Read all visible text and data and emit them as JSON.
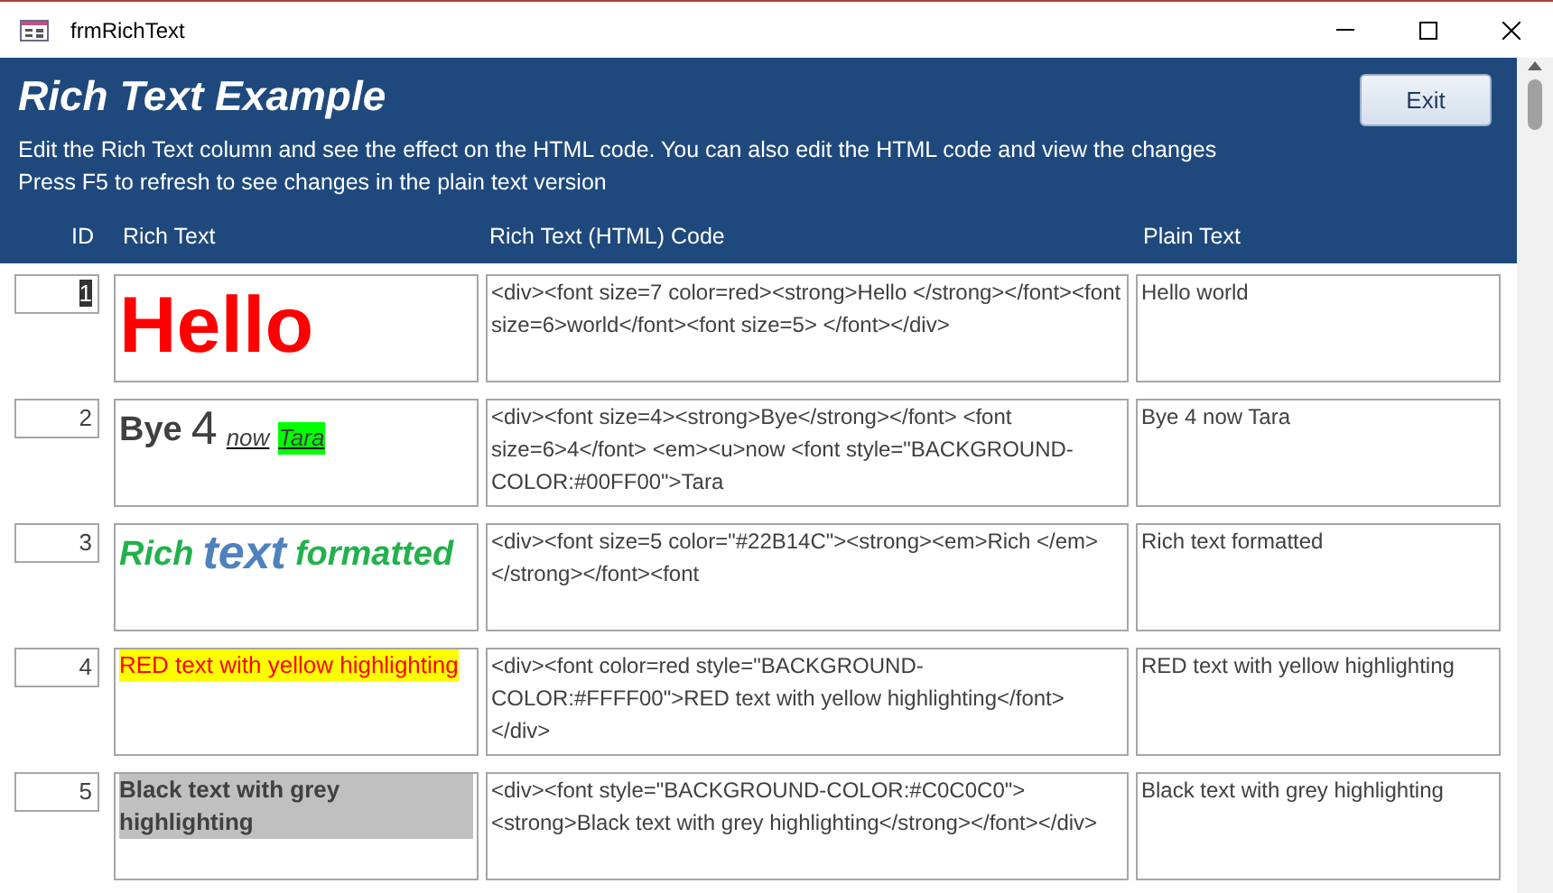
{
  "window": {
    "title": "frmRichText"
  },
  "header": {
    "title": "Rich Text Example",
    "exit_button": "Exit",
    "instructions": [
      "Edit the Rich Text column and see the effect on the HTML code. You can also edit the HTML code and view the changes",
      "Press F5 to refresh to see changes in the plain text version"
    ]
  },
  "table": {
    "columns": [
      "ID",
      "Rich Text",
      "Rich Text (HTML) Code",
      "Plain Text"
    ],
    "rows": [
      {
        "id": "1",
        "selected": true,
        "rich_text": [
          {
            "text": "Hello",
            "kind": "huge",
            "color": "#ff0000",
            "bold": true,
            "italic": false,
            "underline": false
          }
        ],
        "html_code": "<div><font size=7 color=red><strong>Hello </strong></font><font size=6>world</font><font size=5> </font></div>",
        "plain_text": "Hello world"
      },
      {
        "id": "2",
        "selected": false,
        "rich_text": [
          {
            "text": "Bye",
            "kind": "medium",
            "bold": true,
            "italic": false,
            "underline": false
          },
          {
            "text": "4",
            "kind": "large",
            "bold": false,
            "italic": false,
            "underline": false
          },
          {
            "text": "now",
            "kind": "normal",
            "bold": false,
            "italic": true,
            "underline": true
          },
          {
            "text": "Tara",
            "kind": "normal",
            "bold": false,
            "italic": true,
            "underline": true,
            "highlight": {
              "color": "#00ff00"
            }
          }
        ],
        "html_code": "<div><font size=4><strong>Bye</strong></font> <font size=6>4</font> <em><u>now <font style=\"BACKGROUND-COLOR:#00FF00\">Tara",
        "plain_text": "Bye 4 now Tara"
      },
      {
        "id": "3",
        "selected": false,
        "rich_text": [
          {
            "text": "Rich",
            "kind": "medium",
            "color": "#22b14c",
            "bold": true,
            "italic": true,
            "underline": false
          },
          {
            "text": "text",
            "kind": "large",
            "color": "#4f81bd",
            "bold": true,
            "italic": true,
            "underline": false
          },
          {
            "text": "formatted",
            "kind": "medium",
            "color": "#22b14c",
            "bold": true,
            "italic": true,
            "underline": false
          }
        ],
        "html_code": "<div><font size=5 color=\"#22B14C\"><strong><em>Rich </em></strong></font><font",
        "plain_text": "Rich text formatted"
      },
      {
        "id": "4",
        "selected": false,
        "rich_text": [
          {
            "text": "RED text with yellow highlighting",
            "kind": "normal",
            "color": "#ff0000",
            "highlight": {
              "color": "#ffff00"
            },
            "bold": false,
            "italic": false,
            "underline": false
          }
        ],
        "html_code": "<div><font color=red style=\"BACKGROUND-COLOR:#FFFF00\">RED text with yellow highlighting</font></div>",
        "plain_text": "RED text with yellow highlighting"
      },
      {
        "id": "5",
        "selected": false,
        "rich_text": [
          {
            "text": "Black text with grey highlighting",
            "kind": "normal",
            "highlight": {
              "color": "#c0c0c0"
            },
            "bold": true,
            "italic": false,
            "underline": false
          }
        ],
        "html_code": "<div><font style=\"BACKGROUND-COLOR:#C0C0C0\"><strong>Black text with grey highlighting</strong></font></div>",
        "plain_text": "Black text with grey highlighting"
      }
    ]
  }
}
